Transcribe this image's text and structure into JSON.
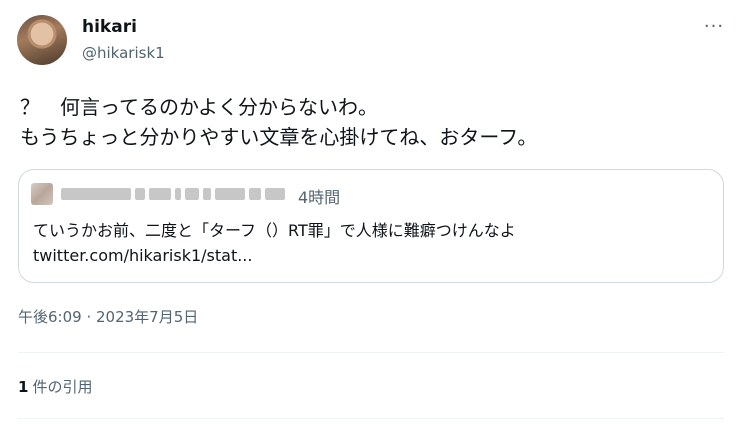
{
  "author": {
    "display_name": "hikari",
    "handle": "@hikarisk1"
  },
  "more_label": "···",
  "tweet_text": "？　何言ってるのかよく分からないわ。\nもうちょっと分かりやすい文章を心掛けてね、おターフ。",
  "quoted": {
    "time": "4時間",
    "text": "ていうかお前、二度と「ターフ（）RT罪」で人様に難癖つけんなよ",
    "link": "twitter.com/hikarisk1/stat..."
  },
  "timestamp": "午後6:09 · 2023年7月5日",
  "quotes": {
    "count": "1",
    "label": "件の引用"
  },
  "colors": {
    "text": "#0f1419",
    "muted": "#536471",
    "border": "#cfd9de",
    "divider": "#eff3f4"
  }
}
